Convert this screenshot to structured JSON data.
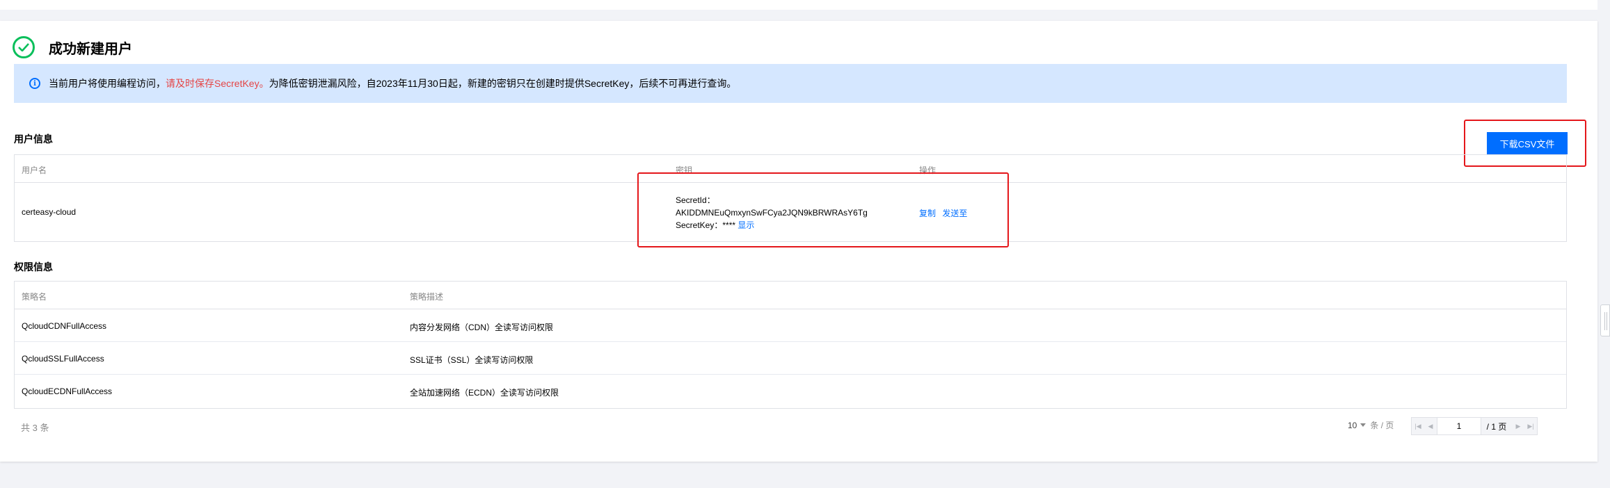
{
  "header": {
    "title": "成功新建用户",
    "icon": "check-circle-icon",
    "icon_color": "#0abf5b"
  },
  "notice": {
    "icon": "info-icon",
    "text_before": "当前用户将使用编程访问，",
    "text_highlight": "请及时保存SecretKey。",
    "text_after": "为降低密钥泄漏风险，自2023年11月30日起，新建的密钥只在创建时提供SecretKey，后续不可再进行查询。"
  },
  "user_info": {
    "title": "用户信息",
    "download_label": "下载CSV文件",
    "columns": [
      "用户名",
      "密钥",
      "操作"
    ],
    "row": {
      "username": "certeasy-cloud",
      "secret_id_label": "SecretId：",
      "secret_id_value": "AKIDDMNEuQmxynSwFCya2JQN9kBRWRAsY6Tg",
      "secret_key_label": "SecretKey：",
      "secret_key_value": "****",
      "show_label": "显示",
      "copy_label": "复制",
      "send_label": "发送至"
    }
  },
  "permissions": {
    "title": "权限信息",
    "columns": [
      "策略名",
      "策略描述"
    ],
    "rows": [
      {
        "name": "QcloudCDNFullAccess",
        "desc": "内容分发网络（CDN）全读写访问权限"
      },
      {
        "name": "QcloudSSLFullAccess",
        "desc": "SSL证书（SSL）全读写访问权限"
      },
      {
        "name": "QcloudECDNFullAccess",
        "desc": "全站加速网络（ECDN）全读写访问权限"
      }
    ]
  },
  "pagination": {
    "total_label": "共 3 条",
    "page_size": "10",
    "page_size_unit": "条 / 页",
    "current_page": "1",
    "total_pages": "/ 1 页"
  },
  "colors": {
    "primary": "#006eff",
    "highlight_red": "#e4161a",
    "notice_bg": "#d5e7ff",
    "warning_text": "#e54545"
  }
}
